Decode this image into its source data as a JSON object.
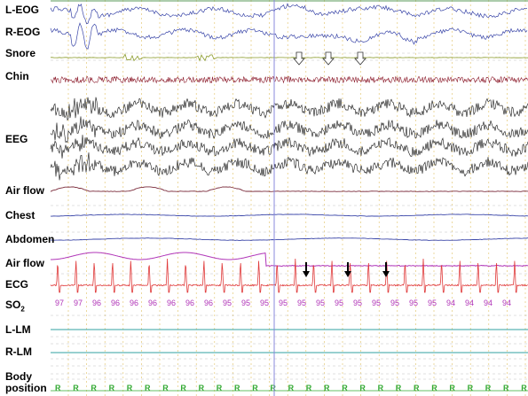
{
  "channels": {
    "l_eog": "L-EOG",
    "r_eog": "R-EOG",
    "snore": "Snore",
    "chin": "Chin",
    "eeg": "EEG",
    "airflow_1": "Air flow",
    "chest": "Chest",
    "abdomen": "Abdomen",
    "airflow_2": "Air flow",
    "ecg": "ECG",
    "so2_main": "SO",
    "so2_sub": "2",
    "l_lm": "L-LM",
    "r_lm": "R-LM",
    "body_position_1": "Body",
    "body_position_2": "position"
  },
  "so2_values": [
    "97",
    "97",
    "96",
    "96",
    "96",
    "96",
    "96",
    "96",
    "96",
    "95",
    "95",
    "95",
    "95",
    "95",
    "95",
    "95",
    "95",
    "95",
    "95",
    "95",
    "95",
    "94",
    "94",
    "94",
    "94"
  ],
  "body_position_values": [
    "R",
    "R",
    "R",
    "R",
    "R",
    "R",
    "R",
    "R",
    "R",
    "R",
    "R",
    "R",
    "R",
    "R",
    "R",
    "R",
    "R",
    "R",
    "R",
    "R",
    "R",
    "R",
    "R",
    "R",
    "R",
    "R",
    "R",
    "R"
  ],
  "colors": {
    "eog": "#3a46a8",
    "snore": "#8a9a2a",
    "chin": "#8b1a2a",
    "eeg": "#111111",
    "airflow_1": "#7a2a3a",
    "chest": "#3a46a8",
    "abdomen": "#3a46a8",
    "airflow_2": "#b035b8",
    "ecg": "#e03a3a",
    "so2": "#b035b8",
    "lm": "#30a0a0",
    "body_position": "#33aa33",
    "grid_dotted": "#e0c060",
    "baseline_dashed": "#c0c0c0",
    "cursor": "#8888dd"
  },
  "markers": {
    "open_arrow_count": 3,
    "filled_arrow_count": 3
  }
}
